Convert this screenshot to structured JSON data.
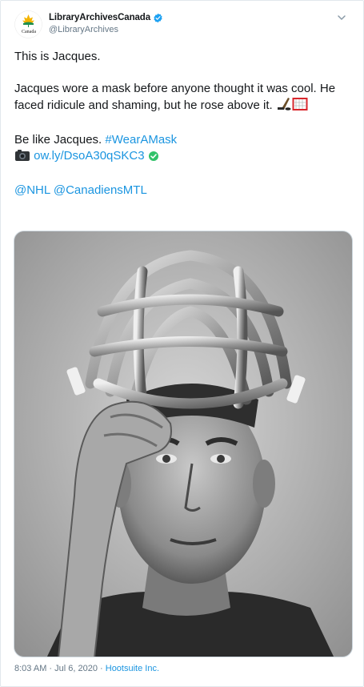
{
  "account": {
    "display_name": "LibraryArchivesCanada",
    "handle": "@LibraryArchives",
    "avatar_caption": "Canada",
    "verified": true,
    "avatar_icon": "maple-leaf-logo",
    "colors": {
      "leaf": "#f4b400",
      "leaf_green": "#1f8f4e",
      "verified": "#1da1f2"
    }
  },
  "tweet": {
    "line1": "This is Jacques.",
    "line2": "Jacques wore a mask before anyone thought it was cool. He faced ridicule and shaming, but he rose above it.",
    "line2_emoji": [
      "hockey-stick-icon",
      "hockey-net-icon"
    ],
    "line3_prefix": "Be like Jacques. ",
    "hashtag": "#WearAMask",
    "link_icon": "camera-icon",
    "link_text": "ow.ly/DsoA30qSKC3",
    "link_badge_icon": "check-circle-icon",
    "mention1": "@NHL",
    "mention2": "@CanadiensMTL"
  },
  "media": {
    "alt": "Black and white photo of a hockey goalie lifting a cage-style mask off his face"
  },
  "meta": {
    "time": "8:03 AM",
    "separator1": " · ",
    "date": "Jul 6, 2020",
    "separator2": " · ",
    "source": "Hootsuite Inc."
  },
  "colors": {
    "link": "#1b95e0",
    "text": "#14171a",
    "muted": "#657786",
    "border": "#e1e8ed"
  }
}
